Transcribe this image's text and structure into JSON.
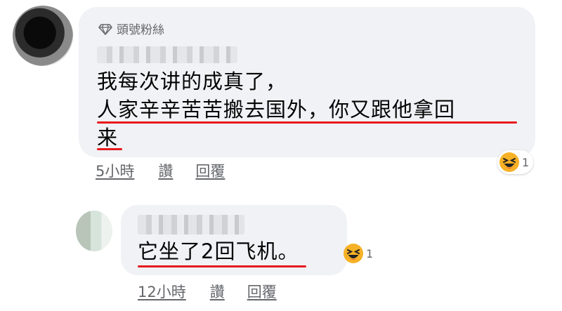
{
  "comment1": {
    "badge": "頭號粉絲",
    "badge_icon": "diamond-icon",
    "lines": [
      "我每次讲的成真了，",
      "人家辛辛苦苦搬去国外，你又跟他拿回",
      "来"
    ],
    "reaction_icon": "haha-emoji-icon",
    "reaction_count": "1",
    "time": "5小時",
    "like": "讚",
    "reply": "回覆"
  },
  "comment2": {
    "text": "它坐了2回飞机。",
    "reaction_icon": "haha-emoji-icon",
    "reaction_count": "1",
    "time": "12小時",
    "like": "讚",
    "reply": "回覆"
  },
  "colors": {
    "underline": "#e8191c",
    "bubble": "#f0f2f5",
    "meta": "#65676b",
    "emoji": "#f7b125"
  }
}
